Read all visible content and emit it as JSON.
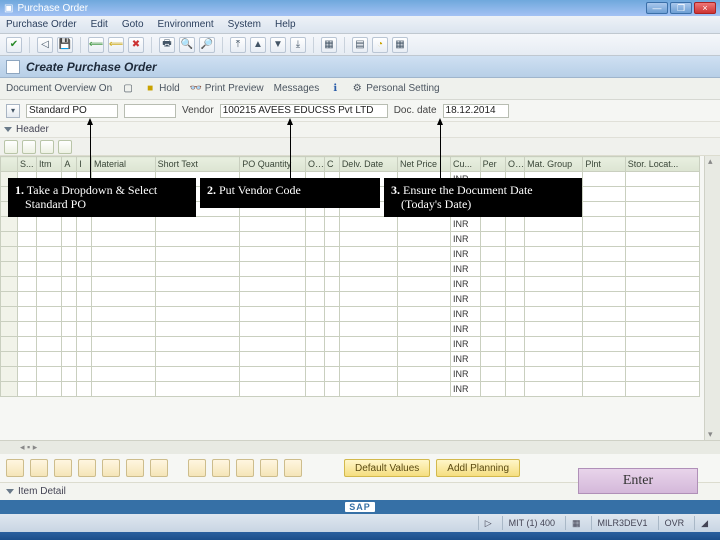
{
  "window": {
    "title": "Purchase Order",
    "min": "—",
    "max": "❐",
    "close": "×"
  },
  "menus": [
    "Purchase Order",
    "Edit",
    "Goto",
    "Environment",
    "System",
    "Help"
  ],
  "page": {
    "title": "Create Purchase Order"
  },
  "subbar": {
    "doc_overview": "Document Overview On",
    "hold": "Hold",
    "print_preview": "Print Preview",
    "messages": "Messages",
    "personal": "Personal Setting"
  },
  "form": {
    "po_type": "Standard PO",
    "vendor_label": "Vendor",
    "vendor_value": "100215 AVEES EDUCSS Pvt LTD",
    "docdate_label": "Doc. date",
    "docdate_value": "18.12.2014"
  },
  "header_label": "Header",
  "columns": [
    "S...",
    "Itm",
    "A",
    "I",
    "Material",
    "Short Text",
    "PO Quantity",
    "O...",
    "C",
    "Delv. Date",
    "Net Price",
    "Cu...",
    "Per",
    "O...",
    "Mat. Group",
    "Plnt",
    "Stor. Locat..."
  ],
  "currency": "INR",
  "lower": {
    "default_values": "Default Values",
    "addl_planning": "Addl Planning"
  },
  "item_detail": "Item Detail",
  "sap": "SAP",
  "status": {
    "server": "MIT (1) 400",
    "host": "MILR3DEV1",
    "mode": "OVR"
  },
  "callouts": {
    "c1a": "1.",
    "c1b": "Take a Dropdown & Select",
    "c1c": "Standard PO",
    "c2a": "2.",
    "c2b": "Put Vendor Code",
    "c3a": "3.",
    "c3b": "Ensure the Document Date",
    "c3c": "(Today's Date)"
  },
  "enter": "Enter"
}
